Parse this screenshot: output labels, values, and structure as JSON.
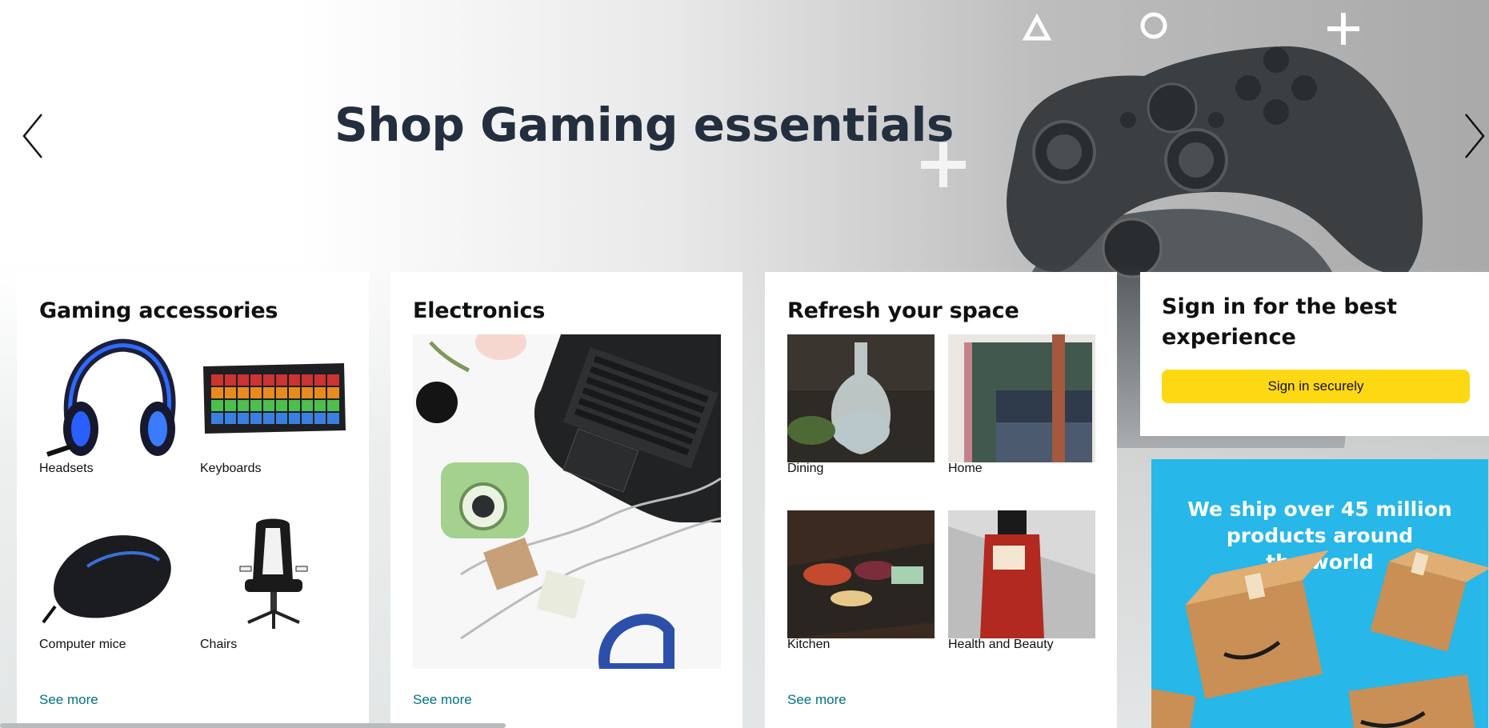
{
  "hero": {
    "title": "Shop Gaming essentials",
    "prev_icon": "chevron-left-icon",
    "next_icon": "chevron-right-icon"
  },
  "cards": {
    "gaming": {
      "title": "Gaming accessories",
      "items": [
        {
          "label": "Headsets",
          "icon": "headset-icon"
        },
        {
          "label": "Keyboards",
          "icon": "keyboard-icon"
        },
        {
          "label": "Computer mice",
          "icon": "mouse-icon"
        },
        {
          "label": "Chairs",
          "icon": "chair-icon"
        }
      ],
      "see_more": "See more"
    },
    "electronics": {
      "title": "Electronics",
      "see_more": "See more"
    },
    "refresh": {
      "title": "Refresh your space",
      "items": [
        {
          "label": "Dining",
          "icon": "carafe-icon"
        },
        {
          "label": "Home",
          "icon": "towels-icon"
        },
        {
          "label": "Kitchen",
          "icon": "food-platter-icon"
        },
        {
          "label": "Health and Beauty",
          "icon": "bottle-icon"
        }
      ],
      "see_more": "See more"
    },
    "signin": {
      "title": "Sign in for the best experience",
      "button": "Sign in securely"
    }
  },
  "ad": {
    "text_line1": "We ship over 45 million",
    "text_line2": "products around",
    "text_line3": "the world"
  },
  "colors": {
    "link": "#007185",
    "button": "#ffd814",
    "ad_bg": "#27b7e8",
    "title": "#232f3e"
  }
}
